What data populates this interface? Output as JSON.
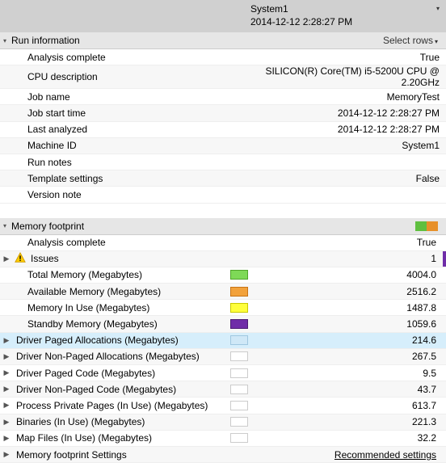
{
  "header": {
    "system": "System1",
    "time": "2014-12-12 2:28:27 PM"
  },
  "runinfo": {
    "title": "Run information",
    "select_rows": "Select rows",
    "rows": [
      {
        "label": "Analysis complete",
        "value": "True"
      },
      {
        "label": "CPU description",
        "value": "SILICON(R) Core(TM) i5-5200U CPU @ 2.20GHz"
      },
      {
        "label": "Job name",
        "value": "MemoryTest"
      },
      {
        "label": "Job start time",
        "value": "2014-12-12 2:28:27 PM"
      },
      {
        "label": "Last analyzed",
        "value": "2014-12-12 2:28:27 PM"
      },
      {
        "label": "Machine ID",
        "value": "System1"
      },
      {
        "label": "Run notes",
        "value": ""
      },
      {
        "label": "Template settings",
        "value": "False"
      },
      {
        "label": "Version note",
        "value": ""
      }
    ]
  },
  "memory": {
    "title": "Memory footprint",
    "rows": [
      {
        "label": "Analysis complete",
        "value": "True"
      },
      {
        "label": "Issues",
        "value": "1",
        "icon": "warn",
        "expandable": true,
        "edge": "purple"
      },
      {
        "label": "Total Memory (Megabytes)",
        "value": "4004.0",
        "swatch": "green"
      },
      {
        "label": "Available Memory (Megabytes)",
        "value": "2516.2",
        "swatch": "orange"
      },
      {
        "label": "Memory In Use (Megabytes)",
        "value": "1487.8",
        "swatch": "yellow"
      },
      {
        "label": "Standby Memory (Megabytes)",
        "value": "1059.6",
        "swatch": "purple"
      },
      {
        "label": "Driver Paged Allocations (Megabytes)",
        "value": "214.6",
        "swatch": "lblue",
        "expandable": true,
        "selected": true
      },
      {
        "label": "Driver Non-Paged Allocations (Megabytes)",
        "value": "267.5",
        "swatch": "white",
        "expandable": true
      },
      {
        "label": "Driver Paged Code (Megabytes)",
        "value": "9.5",
        "swatch": "white",
        "expandable": true
      },
      {
        "label": "Driver Non-Paged Code (Megabytes)",
        "value": "43.7",
        "swatch": "white",
        "expandable": true
      },
      {
        "label": "Process Private Pages (In Use) (Megabytes)",
        "value": "613.7",
        "swatch": "white",
        "expandable": true
      },
      {
        "label": "Binaries (In Use) (Megabytes)",
        "value": "221.3",
        "swatch": "white",
        "expandable": true
      },
      {
        "label": "Map Files (In Use) (Megabytes)",
        "value": "32.2",
        "swatch": "white",
        "expandable": true
      },
      {
        "label": "Memory footprint Settings",
        "value": "Recommended settings",
        "expandable": true,
        "link": true
      }
    ]
  }
}
